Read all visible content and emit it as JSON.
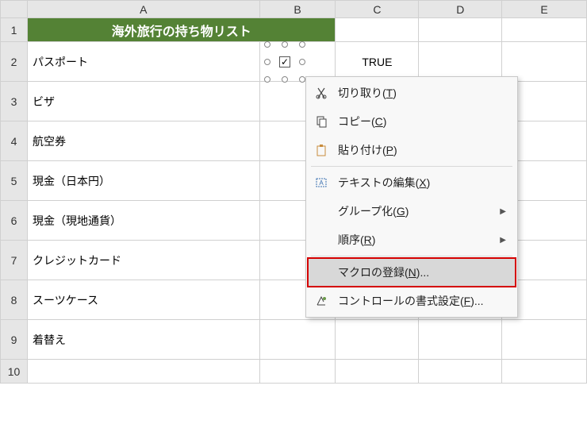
{
  "columns": [
    "A",
    "B",
    "C",
    "D",
    "E"
  ],
  "rows": [
    "1",
    "2",
    "3",
    "4",
    "5",
    "6",
    "7",
    "8",
    "9",
    "10"
  ],
  "header_title": "海外旅行の持ち物リスト",
  "items": {
    "r2": "パスポート",
    "r3": "ビザ",
    "r4": "航空券",
    "r5": "現金（日本円）",
    "r6": "現金（現地通貨）",
    "r7": "クレジットカード",
    "r8": "スーツケース",
    "r9": "着替え"
  },
  "c2_value": "TRUE",
  "checkbox_mark": "✓",
  "menu": {
    "cut": {
      "label": "切り取り(T)"
    },
    "copy": {
      "label": "コピー(C)"
    },
    "paste": {
      "label": "貼り付け(P)"
    },
    "edit": {
      "label": "テキストの編集(X)"
    },
    "group": {
      "label": "グループ化(G)"
    },
    "order": {
      "label": "順序(R)"
    },
    "macro": {
      "label": "マクロの登録(N)..."
    },
    "format": {
      "label": "コントロールの書式設定(F)..."
    }
  }
}
